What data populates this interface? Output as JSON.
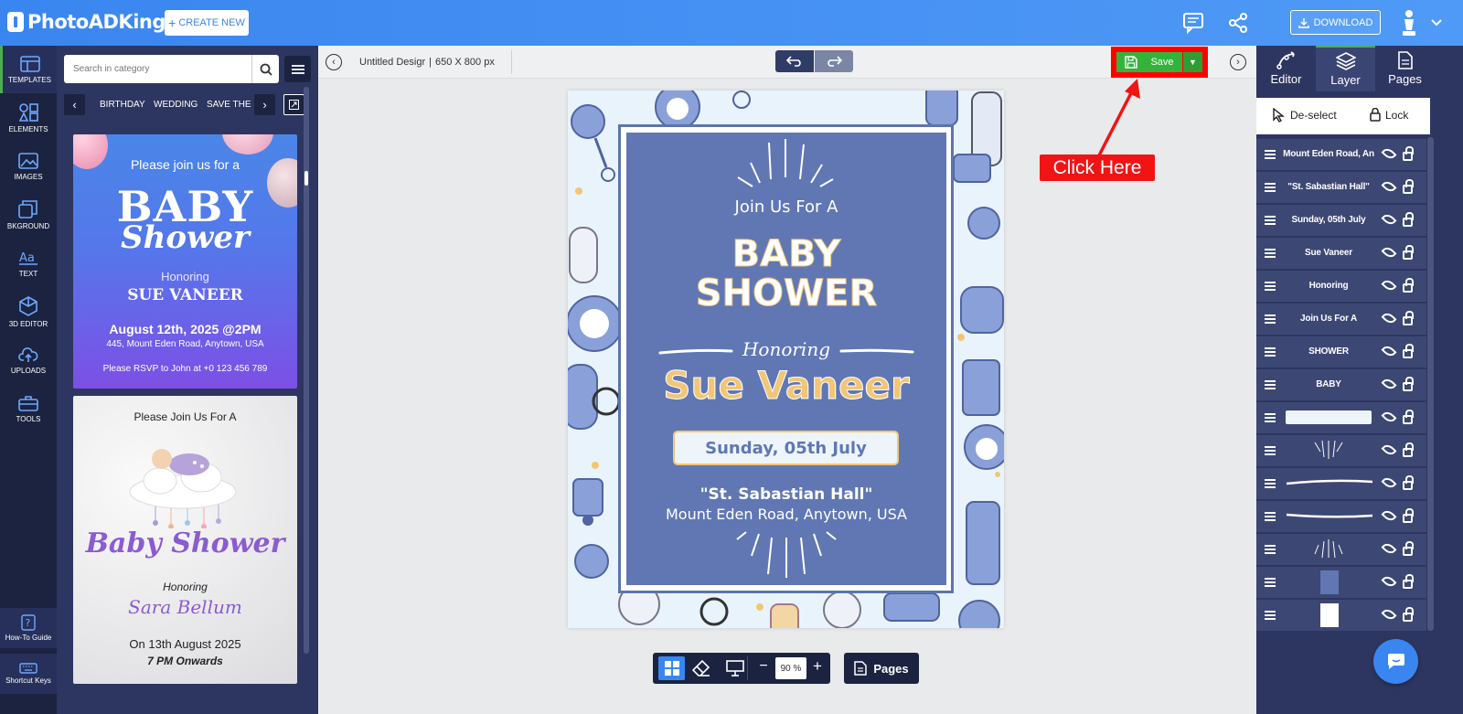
{
  "app": {
    "name": "PhotoADKing"
  },
  "header": {
    "create_new": "CREATE NEW",
    "download": "DOWNLOAD"
  },
  "rail": {
    "items": [
      "TEMPLATES",
      "ELEMENTS",
      "IMAGES",
      "BKGROUND",
      "TEXT",
      "3D EDITOR",
      "UPLOADS",
      "TOOLS"
    ],
    "bottom": [
      "How-To Guide",
      "Shortcut Keys"
    ]
  },
  "catpanel": {
    "search_placeholder": "Search in category",
    "tabs": [
      "BIRTHDAY",
      "WEDDING",
      "SAVE THE"
    ]
  },
  "card1": {
    "line1": "Please join us for a",
    "big": "BABY",
    "script": "Shower",
    "honoring": "Honoring",
    "name": "SUE VANEER",
    "date": "August 12th, 2025 @2PM",
    "address": "445, Mount Eden Road, Anytown, USA",
    "rsvp": "Please RSVP to John at +0 123 456 789"
  },
  "card2": {
    "line1": "Please Join Us For A",
    "title": "Baby Shower",
    "honoring": "Honoring",
    "name": "Sara Bellum",
    "date": "On 13th August 2025",
    "time": "7 PM Onwards"
  },
  "editor": {
    "title": "Untitled Desigr",
    "size": "650 X 800 px",
    "save": "Save",
    "callout": "Click Here",
    "zoom": "90 %",
    "pages": "Pages"
  },
  "design": {
    "join": "Join Us For A",
    "baby": "BABY",
    "shower": "SHOWER",
    "honoring": "Honoring",
    "name": "Sue Vaneer",
    "date": "Sunday, 05th July",
    "venue": "\"St. Sabastian Hall\"",
    "address": "Mount Eden Road, Anytown, USA"
  },
  "rpanel": {
    "tabs": [
      "Editor",
      "Layer",
      "Pages"
    ],
    "deselect": "De-select",
    "lock": "Lock",
    "layers": [
      "Mount Eden Road, An",
      "\"St. Sabastian Hall\"",
      "Sunday, 05th July",
      "Sue Vaneer",
      "Honoring",
      "Join Us For A",
      "SHOWER",
      "BABY"
    ]
  },
  "colors": {
    "accent": "#3a86f0",
    "save_green": "#34b33a",
    "highlight_red": "#ff0000",
    "frame_blue": "#6077b4",
    "gold": "#f2c677"
  }
}
